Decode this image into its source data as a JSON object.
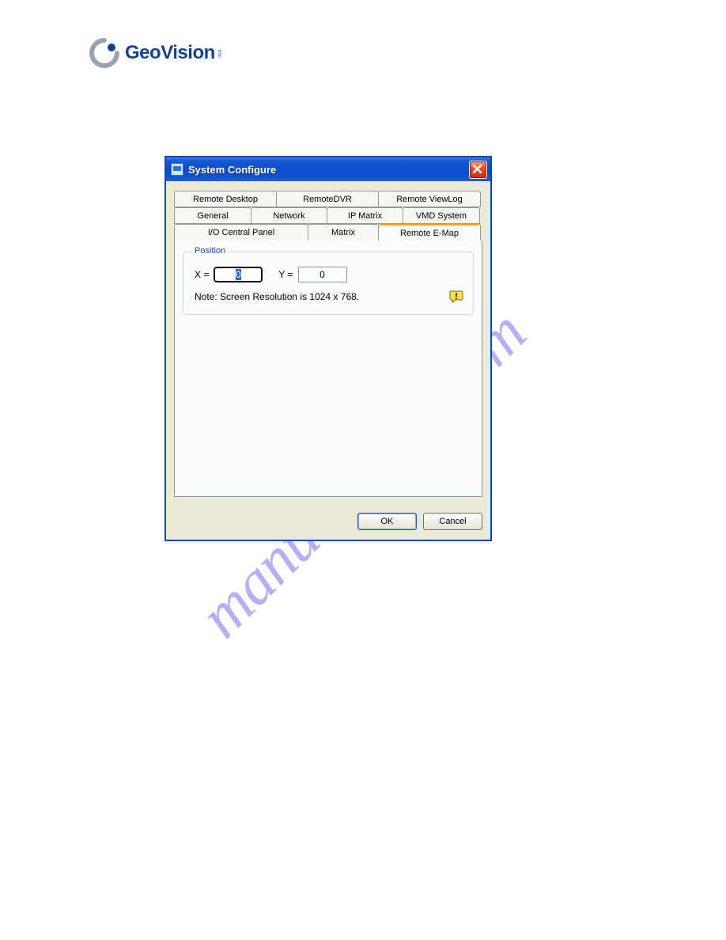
{
  "logo": {
    "text_geo": "Geo",
    "text_vision": "Vision",
    "side": "inc"
  },
  "watermark": "manualshive.com",
  "dialog": {
    "title": "System Configure",
    "tabs": {
      "row1": [
        "Remote Desktop",
        "RemoteDVR",
        "Remote ViewLog"
      ],
      "row2": [
        "General",
        "Network",
        "IP Matrix",
        "VMD System"
      ],
      "row3": [
        "I/O Central Panel",
        "Matrix",
        "Remote E-Map"
      ]
    },
    "group": {
      "title": "Position",
      "x_label": "X =",
      "x_value": "0",
      "y_label": "Y =",
      "y_value": "0",
      "note": "Note: Screen Resolution is 1024 x 768."
    },
    "buttons": {
      "ok": "OK",
      "cancel": "Cancel"
    }
  }
}
